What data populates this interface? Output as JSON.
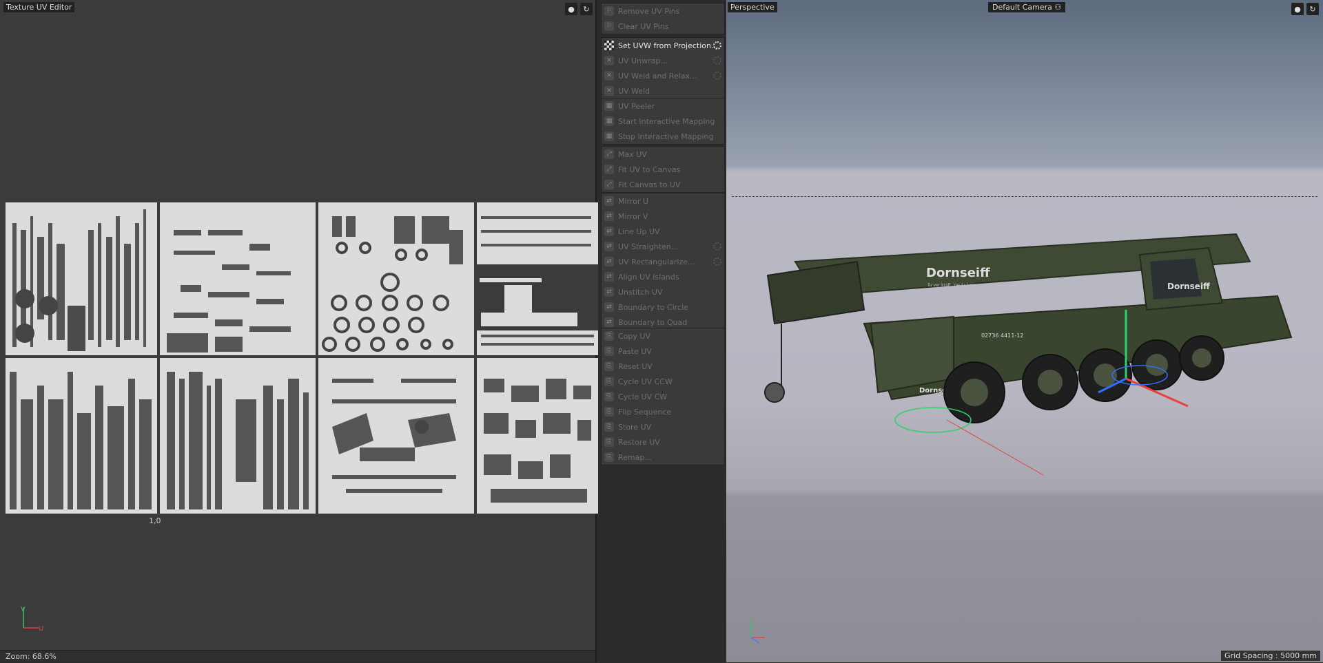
{
  "uv_editor": {
    "title": "Texture UV Editor",
    "coord_label": "1,0",
    "axis_u": "U",
    "axis_v": "V",
    "zoom_status": "Zoom: 68.6%"
  },
  "commands": {
    "groups": [
      {
        "items": [
          {
            "label": "Remove UV Pins",
            "enabled": false,
            "gear": false
          },
          {
            "label": "Clear UV Pins",
            "enabled": false,
            "gear": false
          }
        ]
      },
      {
        "items": [
          {
            "label": "Set UVW from Projection...",
            "enabled": true,
            "gear": true
          },
          {
            "label": "UV Unwrap...",
            "enabled": false,
            "gear": true
          },
          {
            "label": "UV Weld and Relax...",
            "enabled": false,
            "gear": true
          },
          {
            "label": "UV Weld",
            "enabled": false,
            "gear": false
          }
        ]
      },
      {
        "items": [
          {
            "label": "UV Peeler",
            "enabled": false,
            "gear": false
          },
          {
            "label": "Start Interactive Mapping",
            "enabled": false,
            "gear": false
          },
          {
            "label": "Stop Interactive Mapping",
            "enabled": false,
            "gear": false
          }
        ]
      },
      {
        "items": [
          {
            "label": "Max UV",
            "enabled": false,
            "gear": false
          },
          {
            "label": "Fit UV to Canvas",
            "enabled": false,
            "gear": false
          },
          {
            "label": "Fit Canvas to UV",
            "enabled": false,
            "gear": false
          }
        ]
      },
      {
        "items": [
          {
            "label": "Mirror U",
            "enabled": false,
            "gear": false
          },
          {
            "label": "Mirror V",
            "enabled": false,
            "gear": false
          },
          {
            "label": "Line Up UV",
            "enabled": false,
            "gear": false
          },
          {
            "label": "UV Straighten...",
            "enabled": false,
            "gear": true
          },
          {
            "label": "UV Rectangularize...",
            "enabled": false,
            "gear": true
          },
          {
            "label": "Align UV Islands",
            "enabled": false,
            "gear": false
          },
          {
            "label": "Unstitch UV",
            "enabled": false,
            "gear": false
          },
          {
            "label": "Boundary to Circle",
            "enabled": false,
            "gear": false
          },
          {
            "label": "Boundary to Quad",
            "enabled": false,
            "gear": false
          }
        ]
      },
      {
        "items": [
          {
            "label": "Copy UV",
            "enabled": false,
            "gear": false
          },
          {
            "label": "Paste UV",
            "enabled": false,
            "gear": false
          },
          {
            "label": "Reset UV",
            "enabled": false,
            "gear": false
          },
          {
            "label": "Cycle UV CCW",
            "enabled": false,
            "gear": false
          },
          {
            "label": "Cycle UV CW",
            "enabled": false,
            "gear": false
          },
          {
            "label": "Flip Sequence",
            "enabled": false,
            "gear": false
          },
          {
            "label": "Store UV",
            "enabled": false,
            "gear": false
          },
          {
            "label": "Restore UV",
            "enabled": false,
            "gear": false
          },
          {
            "label": "Remap...",
            "enabled": false,
            "gear": false
          }
        ]
      }
    ]
  },
  "viewport": {
    "title": "Perspective",
    "camera": "Default Camera",
    "grid_spacing": "Grid Spacing : 5000 mm",
    "boom_brand": "Dornseiff",
    "boom_tagline": "Tu ver kraft. Heute kein.",
    "cab_brand": "Dornseiff",
    "body_phone": "02736 4411-12",
    "front_brand": "Dornseiff"
  }
}
